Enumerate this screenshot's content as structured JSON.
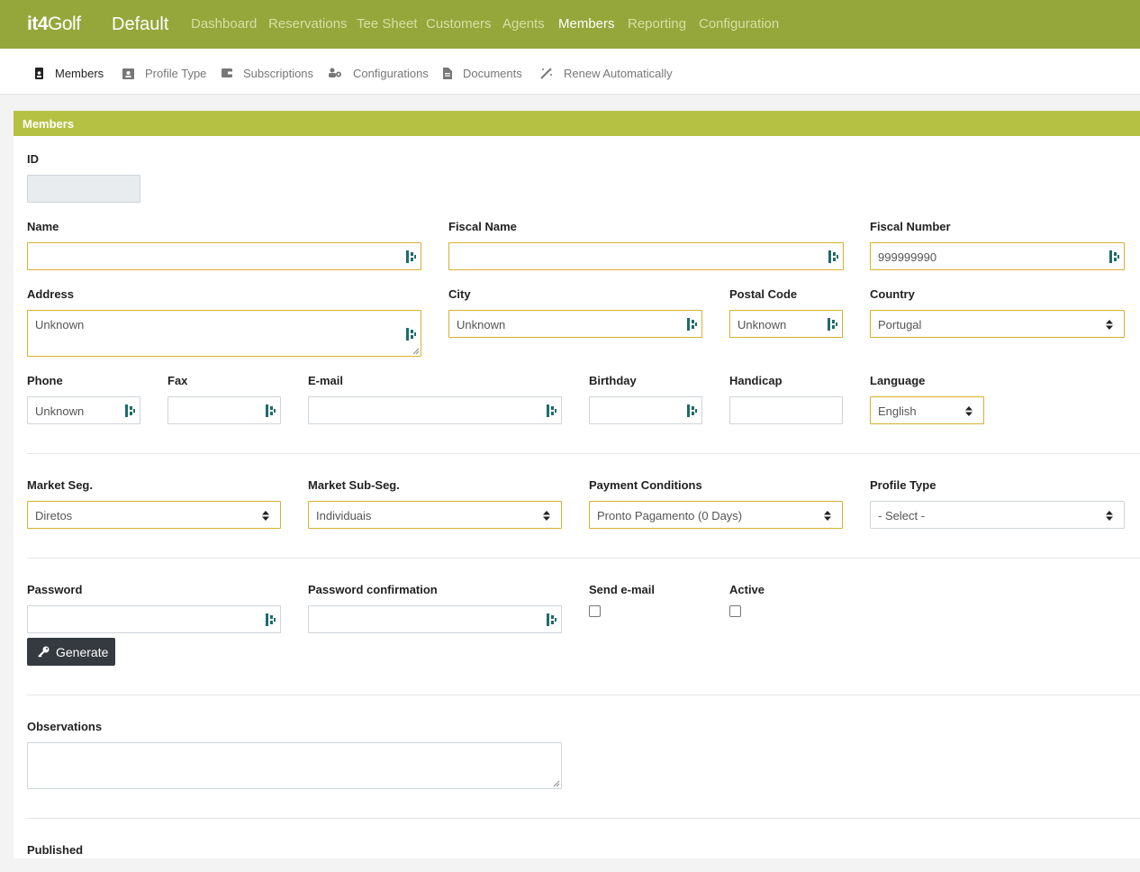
{
  "brand": {
    "logo_text": "it4",
    "logo_suffix": "Golf",
    "app_name": "Default"
  },
  "nav": [
    {
      "label": "Dashboard"
    },
    {
      "label": "Reservations"
    },
    {
      "label": "Tee Sheet"
    },
    {
      "label": "Customers"
    },
    {
      "label": "Agents"
    },
    {
      "label": "Members",
      "active": true
    },
    {
      "label": "Reporting"
    },
    {
      "label": "Configuration"
    }
  ],
  "subnav": [
    {
      "label": "Members",
      "icon": "id-badge-icon",
      "active": true
    },
    {
      "label": "Profile Type",
      "icon": "id-card-icon"
    },
    {
      "label": "Subscriptions",
      "icon": "wallet-icon"
    },
    {
      "label": "Configurations",
      "icon": "users-cog-icon"
    },
    {
      "label": "Documents",
      "icon": "file-icon"
    },
    {
      "label": "Renew Automatically",
      "icon": "magic-wand-icon"
    }
  ],
  "panel": {
    "title": "Members"
  },
  "form": {
    "id": {
      "label": "ID",
      "value": ""
    },
    "name": {
      "label": "Name",
      "value": ""
    },
    "fiscal_name": {
      "label": "Fiscal Name",
      "value": ""
    },
    "fiscal_number": {
      "label": "Fiscal Number",
      "value": "999999990"
    },
    "address": {
      "label": "Address",
      "value": "Unknown"
    },
    "city": {
      "label": "City",
      "value": "Unknown"
    },
    "postal_code": {
      "label": "Postal Code",
      "value": "Unknown"
    },
    "country": {
      "label": "Country",
      "value": "Portugal"
    },
    "phone": {
      "label": "Phone",
      "value": "Unknown"
    },
    "fax": {
      "label": "Fax",
      "value": ""
    },
    "email": {
      "label": "E-mail",
      "value": ""
    },
    "birthday": {
      "label": "Birthday",
      "value": ""
    },
    "handicap": {
      "label": "Handicap",
      "value": ""
    },
    "language": {
      "label": "Language",
      "value": "English"
    },
    "market_seg": {
      "label": "Market Seg.",
      "value": "Diretos"
    },
    "market_sub_seg": {
      "label": "Market Sub-Seg.",
      "value": "Individuais"
    },
    "payment_conditions": {
      "label": "Payment Conditions",
      "value": "Pronto Pagamento (0 Days)"
    },
    "profile_type": {
      "label": "Profile Type",
      "value": "- Select -"
    },
    "password": {
      "label": "Password",
      "value": ""
    },
    "password_confirmation": {
      "label": "Password confirmation",
      "value": ""
    },
    "send_email": {
      "label": "Send e-mail",
      "checked": false
    },
    "active": {
      "label": "Active",
      "checked": false
    },
    "generate_button": "Generate",
    "observations": {
      "label": "Observations",
      "value": ""
    },
    "published": {
      "label": "Published"
    }
  },
  "colors": {
    "topbar": "#95a73b",
    "panel_header": "#b5c143",
    "required_border": "#d6b12f",
    "button": "#343a40"
  }
}
